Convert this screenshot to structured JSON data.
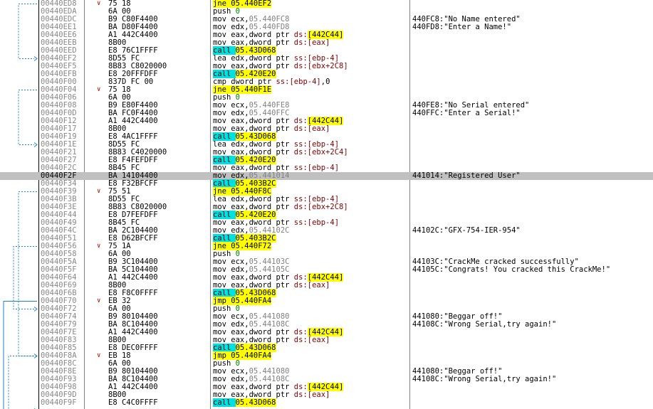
{
  "rows": [
    {
      "addr": "00440ED8",
      "arrow": "∨",
      "bytes": "75 18",
      "disasm": [
        {
          "t": "jne ",
          "c": "hl-yellow"
        },
        {
          "t": "05.440EF2",
          "c": "hl-yellow"
        }
      ],
      "comment": ""
    },
    {
      "addr": "00440EDA",
      "arrow": "",
      "bytes": "6A 00",
      "disasm": [
        {
          "t": "push ",
          "c": ""
        },
        {
          "t": "0",
          "c": "t-green"
        }
      ],
      "comment": ""
    },
    {
      "addr": "00440EDC",
      "arrow": "",
      "bytes": "B9 C80F4400",
      "disasm": [
        {
          "t": "mov ecx,",
          "c": ""
        },
        {
          "t": "05.440FC8",
          "c": "t-grey"
        }
      ],
      "comment": "440FC8:\"No Name entered\""
    },
    {
      "addr": "00440EE1",
      "arrow": "",
      "bytes": "BA D80F4400",
      "disasm": [
        {
          "t": "mov edx,",
          "c": ""
        },
        {
          "t": "05.440FD8",
          "c": "t-grey"
        }
      ],
      "comment": "440FD8:\"Enter a Name!\""
    },
    {
      "addr": "00440EE6",
      "arrow": "",
      "bytes": "A1 442C4400",
      "disasm": [
        {
          "t": "mov eax,dword ptr ",
          "c": ""
        },
        {
          "t": "ds:",
          "c": "t-red"
        },
        {
          "t": "[442C44]",
          "c": "hl-yellow"
        }
      ],
      "comment": ""
    },
    {
      "addr": "00440EEB",
      "arrow": "",
      "bytes": "8B00",
      "disasm": [
        {
          "t": "mov eax,dword ptr ",
          "c": ""
        },
        {
          "t": "ds:",
          "c": "t-red"
        },
        {
          "t": "[eax]",
          "c": "t-red"
        }
      ],
      "comment": ""
    },
    {
      "addr": "00440EED",
      "arrow": "",
      "bytes": "E8 76C1FFFF",
      "disasm": [
        {
          "t": "call ",
          "c": "hl-cyan"
        },
        {
          "t": "05.43D068",
          "c": "hl-yellow"
        }
      ],
      "comment": ""
    },
    {
      "addr": "00440EF2",
      "arrow": "",
      "bytes": "8D55 FC",
      "disasm": [
        {
          "t": "lea edx,dword ptr ",
          "c": ""
        },
        {
          "t": "ss:",
          "c": "t-red"
        },
        {
          "t": "[ebp-4]",
          "c": "t-red"
        }
      ],
      "comment": ""
    },
    {
      "addr": "00440EF5",
      "arrow": "",
      "bytes": "8B83 C8020000",
      "disasm": [
        {
          "t": "mov eax,dword ptr ",
          "c": ""
        },
        {
          "t": "ds:",
          "c": "t-red"
        },
        {
          "t": "[ebx+2C8]",
          "c": "t-red"
        }
      ],
      "comment": ""
    },
    {
      "addr": "00440EFB",
      "arrow": "",
      "bytes": "E8 20FFFDFF",
      "disasm": [
        {
          "t": "call ",
          "c": "hl-cyan"
        },
        {
          "t": "05.420E20",
          "c": "hl-yellow"
        }
      ],
      "comment": ""
    },
    {
      "addr": "00440F00",
      "arrow": "",
      "bytes": "837D FC 00",
      "disasm": [
        {
          "t": "cmp dword ptr ",
          "c": ""
        },
        {
          "t": "ss:",
          "c": "t-red"
        },
        {
          "t": "[ebp-4]",
          "c": "t-red"
        },
        {
          "t": ",0",
          "c": ""
        }
      ],
      "comment": ""
    },
    {
      "addr": "00440F04",
      "arrow": "∨",
      "bytes": "75 18",
      "disasm": [
        {
          "t": "jne ",
          "c": "hl-yellow"
        },
        {
          "t": "05.440F1E",
          "c": "hl-yellow"
        }
      ],
      "comment": ""
    },
    {
      "addr": "00440F06",
      "arrow": "",
      "bytes": "6A 00",
      "disasm": [
        {
          "t": "push ",
          "c": ""
        },
        {
          "t": "0",
          "c": "t-green"
        }
      ],
      "comment": ""
    },
    {
      "addr": "00440F08",
      "arrow": "",
      "bytes": "B9 E80F4400",
      "disasm": [
        {
          "t": "mov ecx,",
          "c": ""
        },
        {
          "t": "05.440FE8",
          "c": "t-grey"
        }
      ],
      "comment": "440FE8:\"No Serial entered\""
    },
    {
      "addr": "00440F0D",
      "arrow": "",
      "bytes": "BA FC0F4400",
      "disasm": [
        {
          "t": "mov edx,",
          "c": ""
        },
        {
          "t": "05.440FFC",
          "c": "t-grey"
        }
      ],
      "comment": "440FFC:\"Enter a Serial!\""
    },
    {
      "addr": "00440F12",
      "arrow": "",
      "bytes": "A1 442C4400",
      "disasm": [
        {
          "t": "mov eax,dword ptr ",
          "c": ""
        },
        {
          "t": "ds:",
          "c": "t-red"
        },
        {
          "t": "[442C44]",
          "c": "hl-yellow"
        }
      ],
      "comment": ""
    },
    {
      "addr": "00440F17",
      "arrow": "",
      "bytes": "8B00",
      "disasm": [
        {
          "t": "mov eax,dword ptr ",
          "c": ""
        },
        {
          "t": "ds:",
          "c": "t-red"
        },
        {
          "t": "[eax]",
          "c": "t-red"
        }
      ],
      "comment": ""
    },
    {
      "addr": "00440F19",
      "arrow": "",
      "bytes": "E8 4AC1FFFF",
      "disasm": [
        {
          "t": "call ",
          "c": "hl-cyan"
        },
        {
          "t": "05.43D068",
          "c": "hl-yellow"
        }
      ],
      "comment": ""
    },
    {
      "addr": "00440F1E",
      "arrow": "",
      "bytes": "8D55 FC",
      "disasm": [
        {
          "t": "lea edx,dword ptr ",
          "c": ""
        },
        {
          "t": "ss:",
          "c": "t-red"
        },
        {
          "t": "[ebp-4]",
          "c": "t-red"
        }
      ],
      "comment": ""
    },
    {
      "addr": "00440F21",
      "arrow": "",
      "bytes": "8B83 C4020000",
      "disasm": [
        {
          "t": "mov eax,dword ptr ",
          "c": ""
        },
        {
          "t": "ds:",
          "c": "t-red"
        },
        {
          "t": "[ebx+2C4]",
          "c": "t-red"
        }
      ],
      "comment": ""
    },
    {
      "addr": "00440F27",
      "arrow": "",
      "bytes": "E8 F4FEFDFF",
      "disasm": [
        {
          "t": "call ",
          "c": "hl-cyan"
        },
        {
          "t": "05.420E20",
          "c": "hl-yellow"
        }
      ],
      "comment": ""
    },
    {
      "addr": "00440F2C",
      "arrow": "",
      "bytes": "8B45 FC",
      "disasm": [
        {
          "t": "mov eax,dword ptr ",
          "c": ""
        },
        {
          "t": "ss:",
          "c": "t-red"
        },
        {
          "t": "[ebp-4]",
          "c": "t-red"
        }
      ],
      "comment": ""
    },
    {
      "addr": "00440F2F",
      "arrow": "",
      "bytes": "BA 14104400",
      "disasm": [
        {
          "t": "mov edx,",
          "c": ""
        },
        {
          "t": "05.441014",
          "c": "t-grey"
        }
      ],
      "comment": "441014:\"Registered User\"",
      "highlight": true
    },
    {
      "addr": "00440F34",
      "arrow": "",
      "bytes": "E8 F32BFCFF",
      "disasm": [
        {
          "t": "call ",
          "c": "hl-cyan"
        },
        {
          "t": "05.403B2C",
          "c": "hl-yellow"
        }
      ],
      "comment": ""
    },
    {
      "addr": "00440F39",
      "arrow": "∨",
      "bytes": "75 51",
      "disasm": [
        {
          "t": "jne ",
          "c": "hl-yellow"
        },
        {
          "t": "05.440F8C",
          "c": "hl-yellow"
        }
      ],
      "comment": ""
    },
    {
      "addr": "00440F3B",
      "arrow": "",
      "bytes": "8D55 FC",
      "disasm": [
        {
          "t": "lea edx,dword ptr ",
          "c": ""
        },
        {
          "t": "ss:",
          "c": "t-red"
        },
        {
          "t": "[ebp-4]",
          "c": "t-red"
        }
      ],
      "comment": ""
    },
    {
      "addr": "00440F3E",
      "arrow": "",
      "bytes": "8B83 C8020000",
      "disasm": [
        {
          "t": "mov eax,dword ptr ",
          "c": ""
        },
        {
          "t": "ds:",
          "c": "t-red"
        },
        {
          "t": "[ebx+2C8]",
          "c": "t-red"
        }
      ],
      "comment": ""
    },
    {
      "addr": "00440F44",
      "arrow": "",
      "bytes": "E8 D7FEFDFF",
      "disasm": [
        {
          "t": "call ",
          "c": "hl-cyan"
        },
        {
          "t": "05.420E20",
          "c": "hl-yellow"
        }
      ],
      "comment": ""
    },
    {
      "addr": "00440F49",
      "arrow": "",
      "bytes": "8B45 FC",
      "disasm": [
        {
          "t": "mov eax,dword ptr ",
          "c": ""
        },
        {
          "t": "ss:",
          "c": "t-red"
        },
        {
          "t": "[ebp-4]",
          "c": "t-red"
        }
      ],
      "comment": ""
    },
    {
      "addr": "00440F4C",
      "arrow": "",
      "bytes": "BA 2C104400",
      "disasm": [
        {
          "t": "mov edx,",
          "c": ""
        },
        {
          "t": "05.44102C",
          "c": "t-grey"
        }
      ],
      "comment": "44102C:\"GFX-754-IER-954\""
    },
    {
      "addr": "00440F51",
      "arrow": "",
      "bytes": "E8 D62BFCFF",
      "disasm": [
        {
          "t": "call ",
          "c": "hl-cyan"
        },
        {
          "t": "05.403B2C",
          "c": "hl-yellow"
        }
      ],
      "comment": ""
    },
    {
      "addr": "00440F56",
      "arrow": "∨",
      "bytes": "75 1A",
      "disasm": [
        {
          "t": "jne ",
          "c": "hl-yellow"
        },
        {
          "t": "05.440F72",
          "c": "hl-yellow"
        }
      ],
      "comment": ""
    },
    {
      "addr": "00440F58",
      "arrow": "",
      "bytes": "6A 00",
      "disasm": [
        {
          "t": "push ",
          "c": ""
        },
        {
          "t": "0",
          "c": "t-green"
        }
      ],
      "comment": ""
    },
    {
      "addr": "00440F5A",
      "arrow": "",
      "bytes": "B9 3C104400",
      "disasm": [
        {
          "t": "mov ecx,",
          "c": ""
        },
        {
          "t": "05.44103C",
          "c": "t-grey"
        }
      ],
      "comment": "44103C:\"CrackMe cracked successfully\""
    },
    {
      "addr": "00440F5F",
      "arrow": "",
      "bytes": "BA 5C104400",
      "disasm": [
        {
          "t": "mov edx,",
          "c": ""
        },
        {
          "t": "05.44105C",
          "c": "t-grey"
        }
      ],
      "comment": "44105C:\"Congrats! You cracked this CrackMe!\""
    },
    {
      "addr": "00440F64",
      "arrow": "",
      "bytes": "A1 442C4400",
      "disasm": [
        {
          "t": "mov eax,dword ptr ",
          "c": ""
        },
        {
          "t": "ds:",
          "c": "t-red"
        },
        {
          "t": "[442C44]",
          "c": "hl-yellow"
        }
      ],
      "comment": ""
    },
    {
      "addr": "00440F69",
      "arrow": "",
      "bytes": "8B00",
      "disasm": [
        {
          "t": "mov eax,dword ptr ",
          "c": ""
        },
        {
          "t": "ds:",
          "c": "t-red"
        },
        {
          "t": "[eax]",
          "c": "t-red"
        }
      ],
      "comment": ""
    },
    {
      "addr": "00440F6B",
      "arrow": "",
      "bytes": "E8 F8C0FFFF",
      "disasm": [
        {
          "t": "call ",
          "c": "hl-cyan"
        },
        {
          "t": "05.43D068",
          "c": "hl-yellow"
        }
      ],
      "comment": ""
    },
    {
      "addr": "00440F70",
      "arrow": "∨",
      "bytes": "EB 32",
      "disasm": [
        {
          "t": "jmp ",
          "c": "hl-yellow"
        },
        {
          "t": "05.440FA4",
          "c": "hl-yellow"
        }
      ],
      "comment": ""
    },
    {
      "addr": "00440F72",
      "arrow": "",
      "bytes": "6A 00",
      "disasm": [
        {
          "t": "push ",
          "c": ""
        },
        {
          "t": "0",
          "c": "t-green"
        }
      ],
      "comment": ""
    },
    {
      "addr": "00440F74",
      "arrow": "",
      "bytes": "B9 80104400",
      "disasm": [
        {
          "t": "mov ecx,",
          "c": ""
        },
        {
          "t": "05.441080",
          "c": "t-grey"
        }
      ],
      "comment": "441080:\"Beggar off!\""
    },
    {
      "addr": "00440F79",
      "arrow": "",
      "bytes": "BA 8C104400",
      "disasm": [
        {
          "t": "mov edx,",
          "c": ""
        },
        {
          "t": "05.44108C",
          "c": "t-grey"
        }
      ],
      "comment": "44108C:\"Wrong Serial,try again!\""
    },
    {
      "addr": "00440F7E",
      "arrow": "",
      "bytes": "A1 442C4400",
      "disasm": [
        {
          "t": "mov eax,dword ptr ",
          "c": ""
        },
        {
          "t": "ds:",
          "c": "t-red"
        },
        {
          "t": "[442C44]",
          "c": "hl-yellow"
        }
      ],
      "comment": ""
    },
    {
      "addr": "00440F83",
      "arrow": "",
      "bytes": "8B00",
      "disasm": [
        {
          "t": "mov eax,dword ptr ",
          "c": ""
        },
        {
          "t": "ds:",
          "c": "t-red"
        },
        {
          "t": "[eax]",
          "c": "t-red"
        }
      ],
      "comment": ""
    },
    {
      "addr": "00440F85",
      "arrow": "",
      "bytes": "E8 DEC0FFFF",
      "disasm": [
        {
          "t": "call ",
          "c": "hl-cyan"
        },
        {
          "t": "05.43D068",
          "c": "hl-yellow"
        }
      ],
      "comment": ""
    },
    {
      "addr": "00440F8A",
      "arrow": "∨",
      "bytes": "EB 18",
      "disasm": [
        {
          "t": "jmp ",
          "c": "hl-yellow"
        },
        {
          "t": "05.440FA4",
          "c": "hl-yellow"
        }
      ],
      "comment": ""
    },
    {
      "addr": "00440F8C",
      "arrow": "",
      "bytes": "6A 00",
      "disasm": [
        {
          "t": "push ",
          "c": ""
        },
        {
          "t": "0",
          "c": "t-green"
        }
      ],
      "comment": ""
    },
    {
      "addr": "00440F8E",
      "arrow": "",
      "bytes": "B9 80104400",
      "disasm": [
        {
          "t": "mov ecx,",
          "c": ""
        },
        {
          "t": "05.441080",
          "c": "t-grey"
        }
      ],
      "comment": "441080:\"Beggar off!\""
    },
    {
      "addr": "00440F93",
      "arrow": "",
      "bytes": "BA 8C104400",
      "disasm": [
        {
          "t": "mov edx,",
          "c": ""
        },
        {
          "t": "05.44108C",
          "c": "t-grey"
        }
      ],
      "comment": "44108C:\"Wrong Serial,try again!\""
    },
    {
      "addr": "00440F98",
      "arrow": "",
      "bytes": "A1 442C4400",
      "disasm": [
        {
          "t": "mov eax,dword ptr ",
          "c": ""
        },
        {
          "t": "ds:",
          "c": "t-red"
        },
        {
          "t": "[442C44]",
          "c": "hl-yellow"
        }
      ],
      "comment": ""
    },
    {
      "addr": "00440F9D",
      "arrow": "",
      "bytes": "8B00",
      "disasm": [
        {
          "t": "mov eax,dword ptr ",
          "c": ""
        },
        {
          "t": "ds:",
          "c": "t-red"
        },
        {
          "t": "[eax]",
          "c": "t-red"
        }
      ],
      "comment": ""
    },
    {
      "addr": "00440F9F",
      "arrow": "",
      "bytes": "E8 C4C0FFFF",
      "disasm": [
        {
          "t": "call ",
          "c": "hl-cyan"
        },
        {
          "t": "05.43D068",
          "c": "hl-yellow"
        }
      ],
      "comment": ""
    }
  ],
  "jumps": [
    {
      "from": 0,
      "to": 7,
      "style": "dashed",
      "lane": 3
    },
    {
      "from": 11,
      "to": 18,
      "style": "dashed",
      "lane": 3
    },
    {
      "from": 24,
      "to": 45,
      "style": "dashed",
      "lane": 3
    },
    {
      "from": 31,
      "to": 39,
      "style": "dashed",
      "lane": 2
    },
    {
      "from": 38,
      "to": 52,
      "style": "solid",
      "lane": 0
    },
    {
      "from": 45,
      "to": 52,
      "style": "dashed",
      "lane": 1
    }
  ],
  "colors": {
    "highlight_row": "#c0c0c0",
    "jump_line": "#1e7fd0",
    "mnemonic_highlight": "#ffff00",
    "call_highlight": "#00e0e0"
  }
}
